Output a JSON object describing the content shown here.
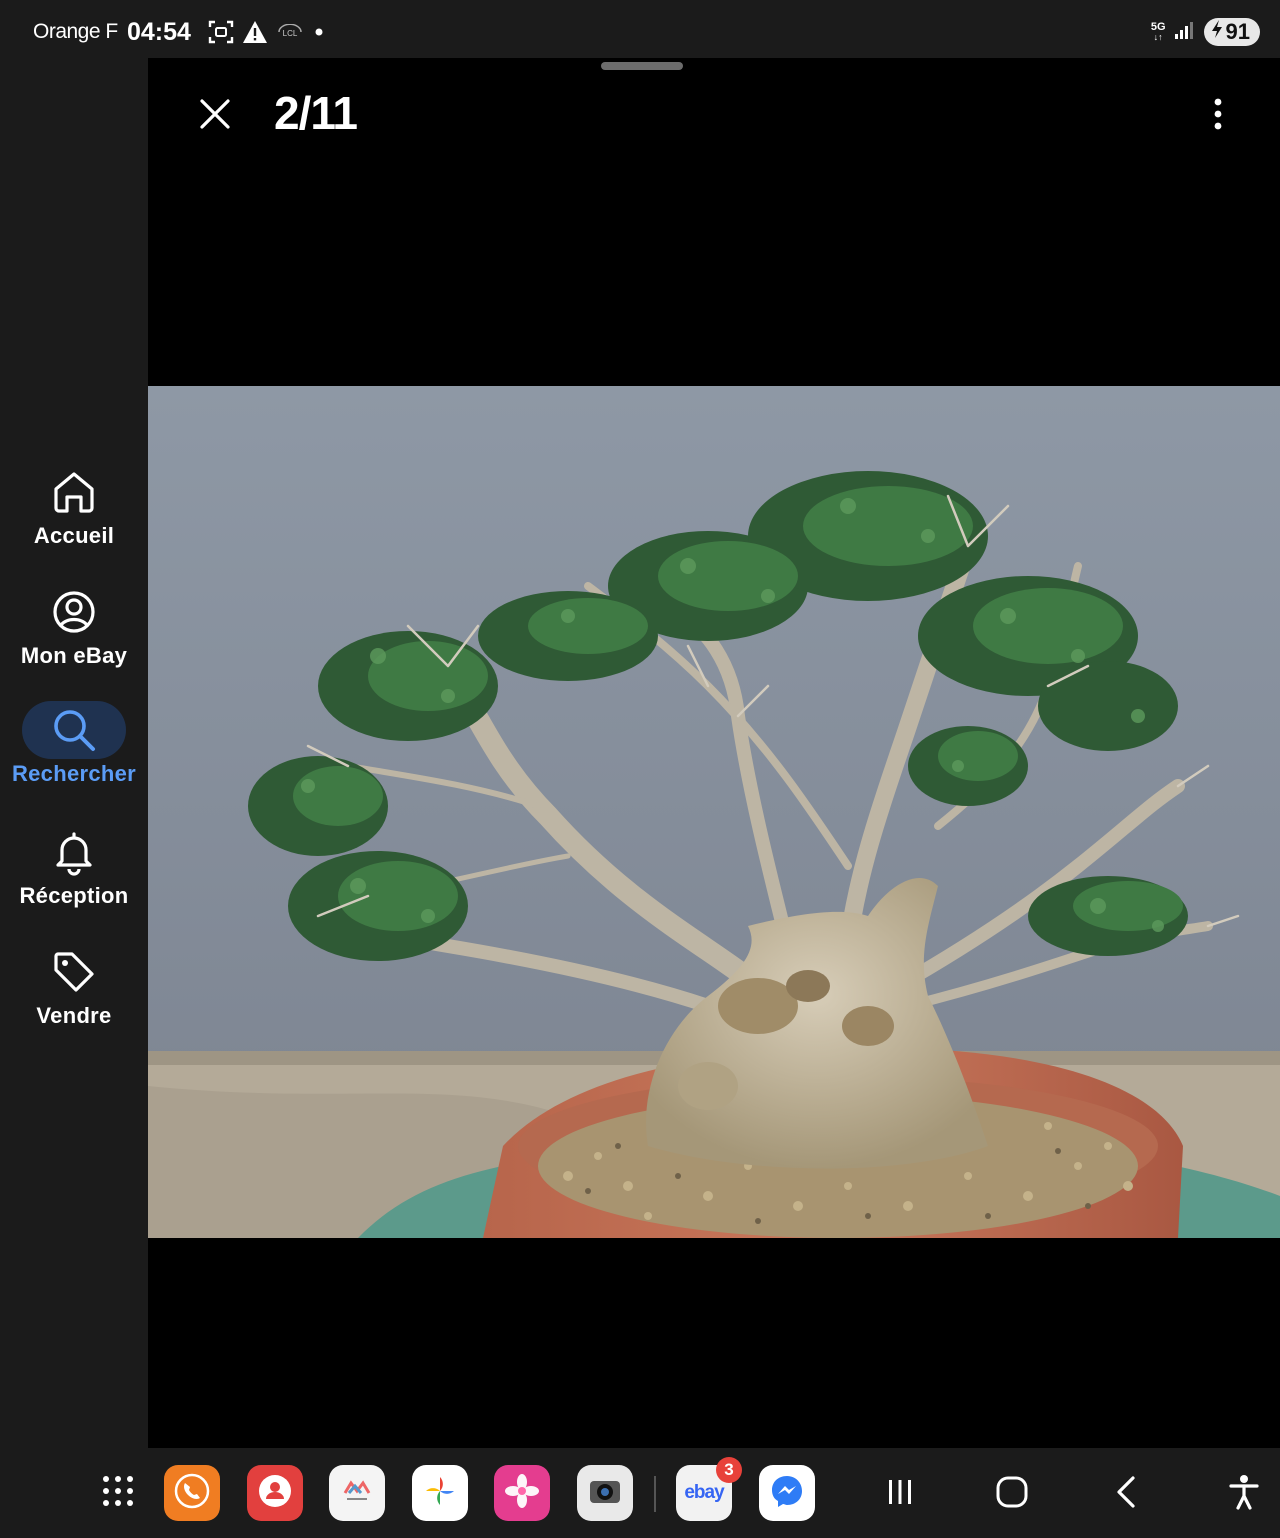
{
  "status_bar": {
    "carrier": "Orange F",
    "time": "04:54",
    "network": "5G",
    "battery": "91"
  },
  "nav_rail": {
    "items": [
      {
        "label": "Accueil",
        "icon": "home-icon",
        "active": false
      },
      {
        "label": "Mon eBay",
        "icon": "account-icon",
        "active": false
      },
      {
        "label": "Rechercher",
        "icon": "search-icon",
        "active": true
      },
      {
        "label": "Réception",
        "icon": "bell-icon",
        "active": false
      },
      {
        "label": "Vendre",
        "icon": "tag-icon",
        "active": false
      }
    ]
  },
  "viewer": {
    "counter": "2/11",
    "image_subject": "bonsai-tree-photo"
  },
  "dock": {
    "apps": [
      "apps-grid-icon",
      "phone-app-icon",
      "contacts-app-icon",
      "family-album-app-icon",
      "google-photos-app-icon",
      "gallery-app-icon",
      "camera-app-icon",
      "ebay-app-icon",
      "messenger-app-icon"
    ],
    "ebay_app_label": "ebay",
    "ebay_badge": "3"
  },
  "colors": {
    "accent": "#5b9cf5",
    "active_pill": "#1f3250",
    "background": "#1b1b1b",
    "viewer_bg": "#000000"
  }
}
